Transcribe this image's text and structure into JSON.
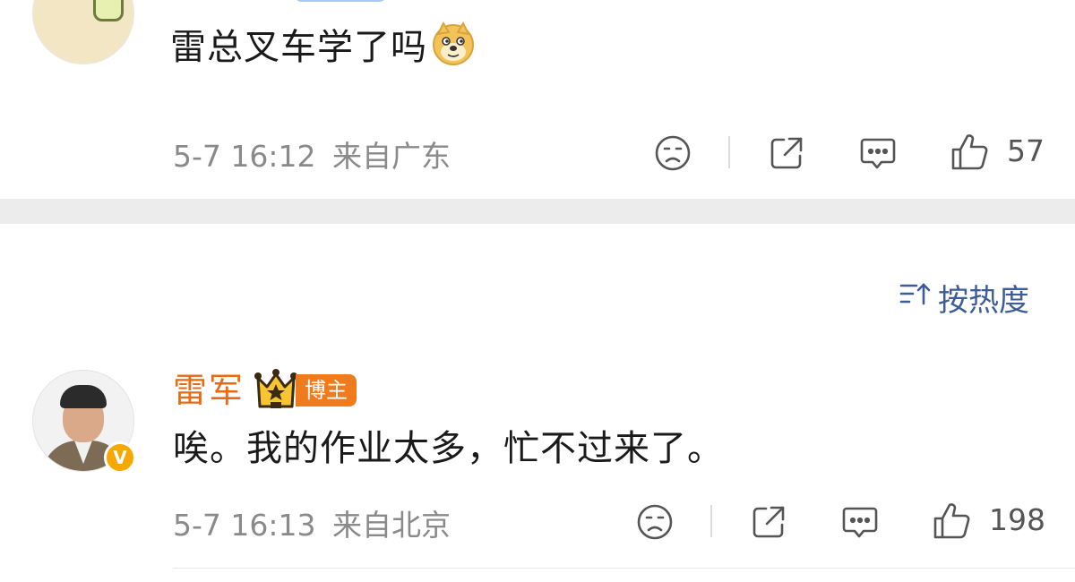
{
  "comments": [
    {
      "text": "雷总叉车学了吗",
      "emoji": "doge-emoji",
      "time": "5-7 16:12",
      "location": "来自广东",
      "like_count": "57"
    },
    {
      "author": "雷军",
      "role_badge": "博主",
      "verified_badge": "V",
      "text": "唉。我的作业太多，忙不过来了。",
      "time": "5-7 16:13",
      "location": "来自北京",
      "like_count": "198"
    }
  ],
  "sort": {
    "label": "按热度"
  },
  "colors": {
    "author_name": "#e86a12",
    "role_badge_bg": "#f07b1d",
    "sort_text": "#3d5d99",
    "meta_text": "#8a8a8a",
    "divider_band": "#ececec"
  },
  "icons": [
    "sad-face-icon",
    "share-icon",
    "comment-icon",
    "thumbs-up-icon",
    "sort-icon",
    "crown-icon"
  ]
}
